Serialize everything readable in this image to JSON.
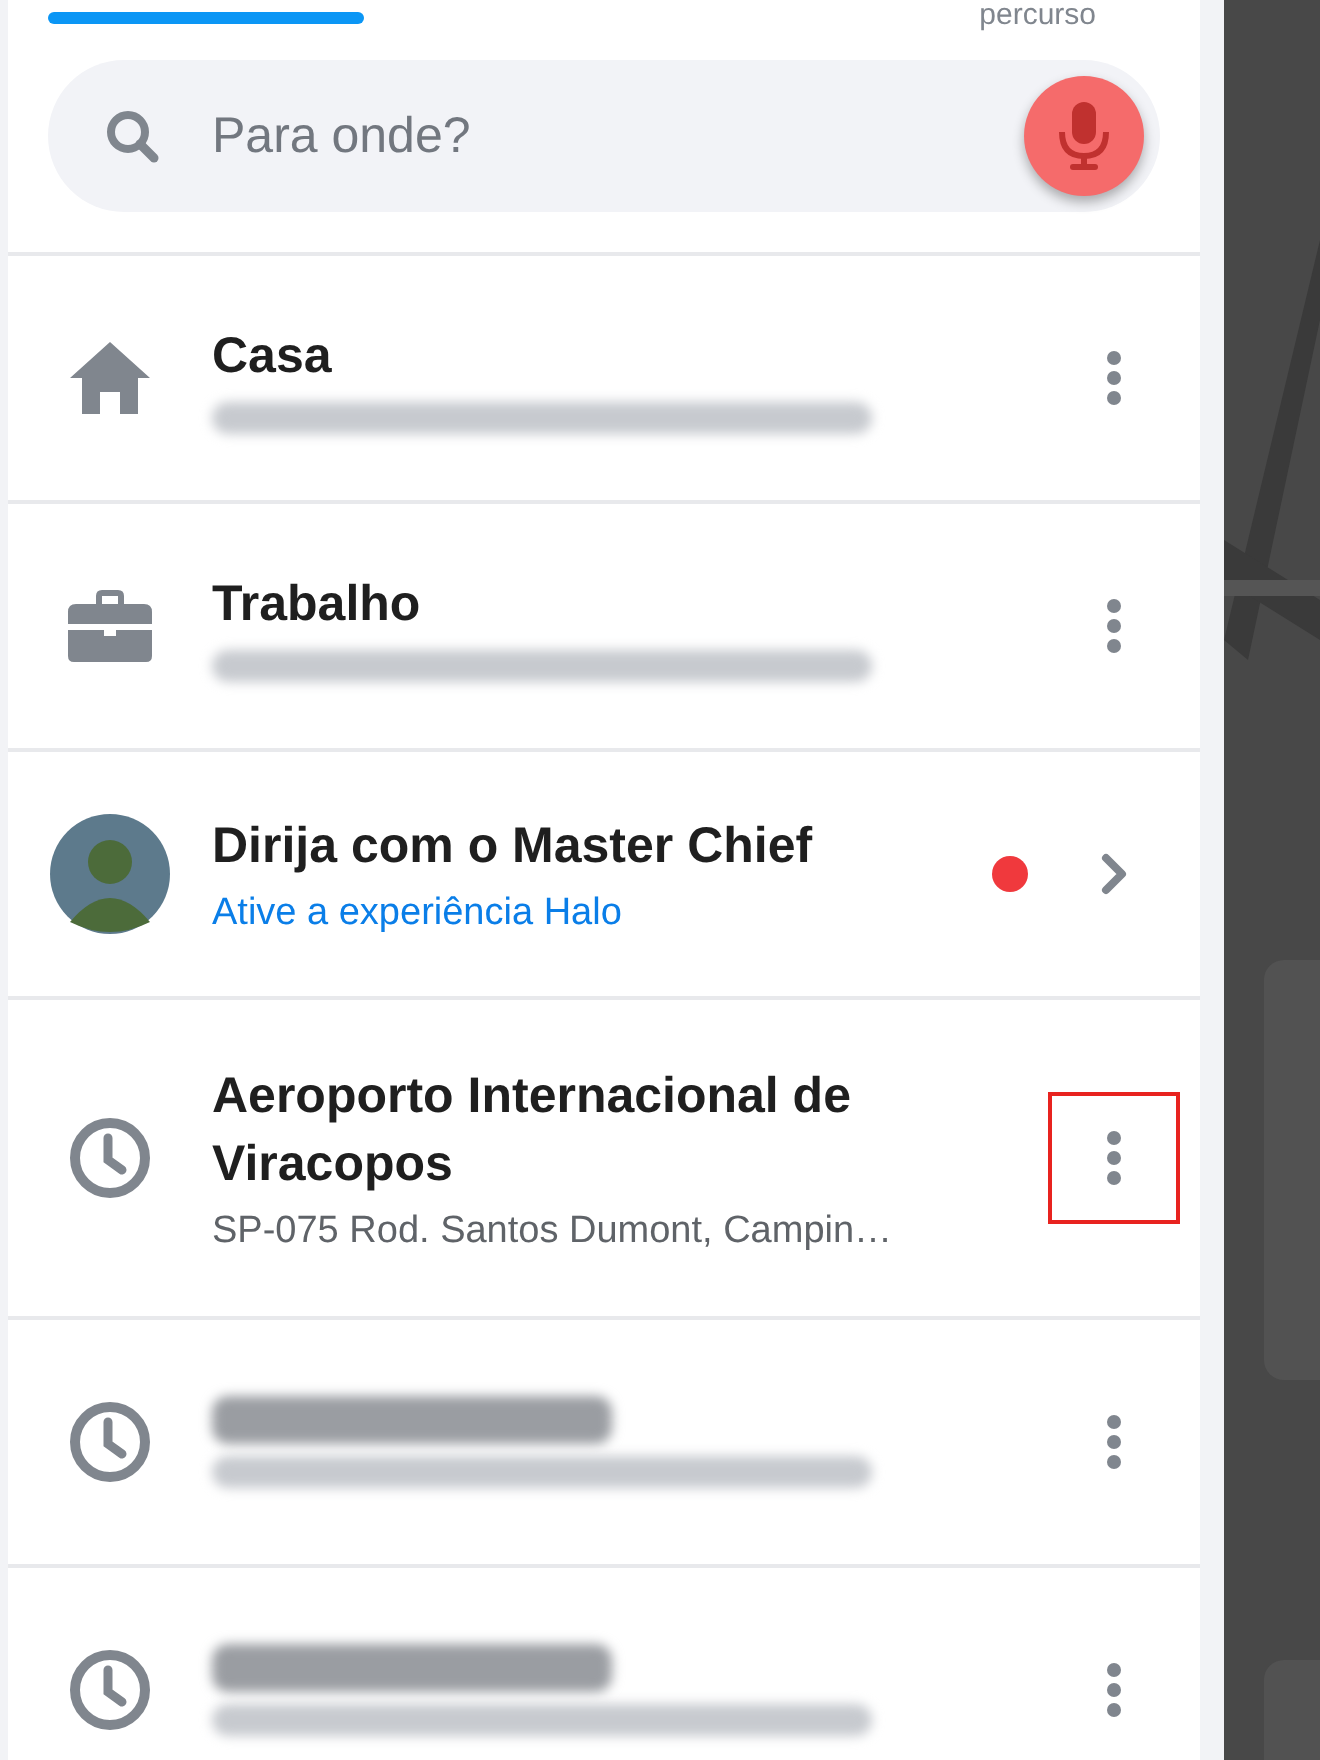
{
  "top_tab": {
    "label": "percurso",
    "indicator_selected": true
  },
  "search": {
    "placeholder": "Para onde?"
  },
  "places": [
    {
      "kind": "home",
      "title": "Casa",
      "subtitle_redacted": true,
      "chevron": false,
      "highlighted": false
    },
    {
      "kind": "work",
      "title": "Trabalho",
      "subtitle_redacted": true,
      "chevron": false,
      "highlighted": false
    },
    {
      "kind": "promo",
      "title": "Dirija com o Master Chief",
      "link": "Ative a experiência Halo",
      "chevron": true,
      "new_dot": true,
      "color": "#f0393d",
      "highlighted": false
    },
    {
      "kind": "recent",
      "title": "Aeroporto Internacional de Viracopos",
      "subtitle": "SP-075 Rod. Santos Dumont, Campin…",
      "chevron": false,
      "highlighted": true
    },
    {
      "kind": "recent",
      "title_redacted": true,
      "subtitle_redacted": true,
      "chevron": false,
      "highlighted": false
    },
    {
      "kind": "recent",
      "title_redacted": true,
      "subtitle_redacted": true,
      "chevron": false,
      "highlighted": false
    }
  ]
}
